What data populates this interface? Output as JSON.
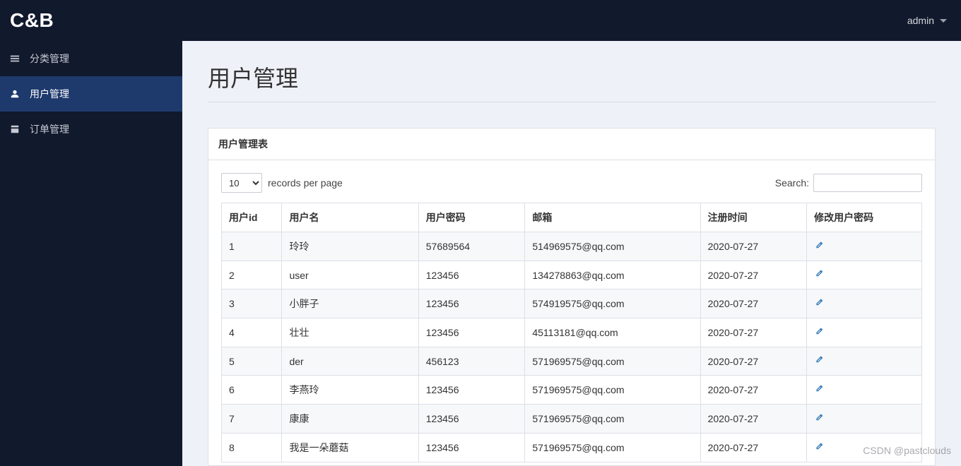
{
  "brand": "C&B",
  "header": {
    "username": "admin"
  },
  "sidebar": {
    "items": [
      {
        "label": "分类管理",
        "icon": "menu-icon"
      },
      {
        "label": "用户管理",
        "icon": "user-icon"
      },
      {
        "label": "订单管理",
        "icon": "order-icon"
      }
    ],
    "active_index": 1
  },
  "page": {
    "title": "用户管理",
    "panel_title": "用户管理表"
  },
  "toolbar": {
    "page_size": "10",
    "page_size_suffix": "records per page",
    "search_label": "Search:"
  },
  "table": {
    "columns": [
      "用户id",
      "用户名",
      "用户密码",
      "邮箱",
      "注册时间",
      "修改用户密码"
    ],
    "rows": [
      {
        "id": "1",
        "username": "玲玲",
        "password": "57689564",
        "email": "514969575@qq.com",
        "reg_date": "2020-07-27"
      },
      {
        "id": "2",
        "username": "user",
        "password": "123456",
        "email": "134278863@qq.com",
        "reg_date": "2020-07-27"
      },
      {
        "id": "3",
        "username": "小胖子",
        "password": "123456",
        "email": "574919575@qq.com",
        "reg_date": "2020-07-27"
      },
      {
        "id": "4",
        "username": "壮壮",
        "password": "123456",
        "email": "45113181@qq.com",
        "reg_date": "2020-07-27"
      },
      {
        "id": "5",
        "username": "der",
        "password": "456123",
        "email": "571969575@qq.com",
        "reg_date": "2020-07-27"
      },
      {
        "id": "6",
        "username": "李燕玲",
        "password": "123456",
        "email": "571969575@qq.com",
        "reg_date": "2020-07-27"
      },
      {
        "id": "7",
        "username": "康康",
        "password": "123456",
        "email": "571969575@qq.com",
        "reg_date": "2020-07-27"
      },
      {
        "id": "8",
        "username": "我是一朵蘑菇",
        "password": "123456",
        "email": "571969575@qq.com",
        "reg_date": "2020-07-27"
      }
    ]
  },
  "watermark": "CSDN @pastclouds"
}
